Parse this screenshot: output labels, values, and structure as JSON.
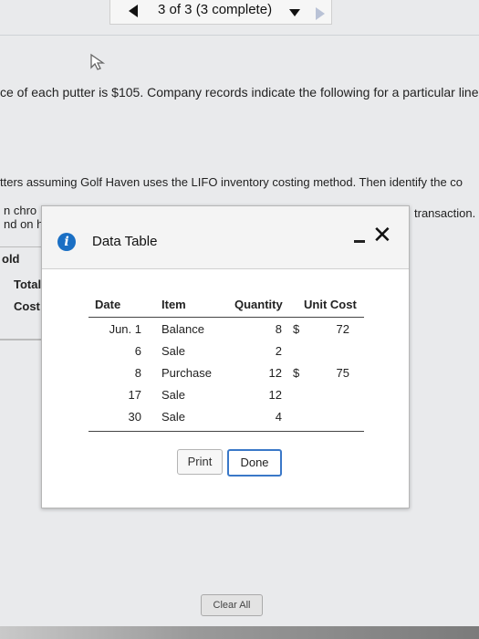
{
  "pager": {
    "label": "3 of 3 (3 complete)"
  },
  "question": {
    "line1": "ce of each putter is $105. Company records indicate the following for a particular line o",
    "line2": "tters assuming Golf Haven uses the LIFO inventory costing method. Then identify the co",
    "line3_left": "n chro",
    "line3_right": "transaction.",
    "line4": "nd on h"
  },
  "answer_labels": {
    "sold": "old",
    "total": "Total",
    "cost": "Cost"
  },
  "dialog": {
    "title": "Data Table",
    "table": {
      "headers": [
        "Date",
        "Item",
        "Quantity",
        "Unit Cost"
      ],
      "rows": [
        {
          "date": "Jun. 1",
          "item": "Balance",
          "quantity": "8",
          "dollar": "$",
          "unit_cost": "72"
        },
        {
          "date": "6",
          "item": "Sale",
          "quantity": "2",
          "dollar": "",
          "unit_cost": ""
        },
        {
          "date": "8",
          "item": "Purchase",
          "quantity": "12",
          "dollar": "$",
          "unit_cost": "75"
        },
        {
          "date": "17",
          "item": "Sale",
          "quantity": "12",
          "dollar": "",
          "unit_cost": ""
        },
        {
          "date": "30",
          "item": "Sale",
          "quantity": "4",
          "dollar": "",
          "unit_cost": ""
        }
      ]
    },
    "print_label": "Print",
    "done_label": "Done"
  },
  "clear_all_label": "Clear All"
}
